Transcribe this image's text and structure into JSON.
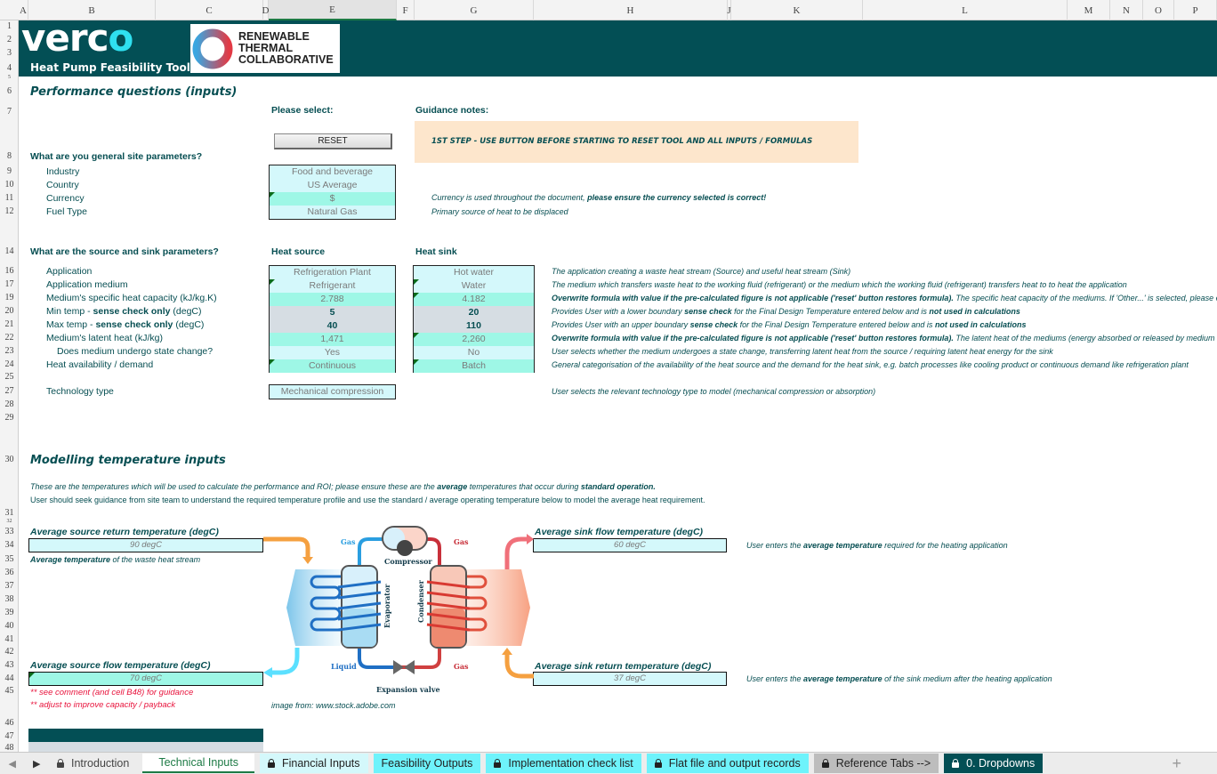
{
  "columns": [
    "A",
    "B",
    "C",
    "D",
    "E",
    "F",
    "G",
    "H",
    "J",
    "K",
    "L",
    "M",
    "N",
    "O",
    "P"
  ],
  "rows": [
    "1",
    "2",
    "3",
    "4",
    "5",
    "6",
    "7",
    "8",
    "9",
    "10",
    "11",
    "12",
    "14",
    "16",
    "17",
    "19",
    "20",
    "21",
    "22",
    "23",
    "24",
    "25",
    "27",
    "28",
    "29",
    "30",
    "31",
    "32",
    "33",
    "34",
    "35",
    "36",
    "37",
    "38",
    "39",
    "40",
    "41",
    "42",
    "43",
    "44",
    "45",
    "46",
    "47",
    "48"
  ],
  "header": {
    "logo": "verco",
    "logo_o": "o",
    "logo_main": "verc",
    "tool_title": "Heat Pump Feasibility Tool",
    "partner_logo": "RENEWABLE THERMAL COLLABORATIVE",
    "partner_lines": [
      "RENEWABLE",
      "THERMAL",
      "COLLABORATIVE"
    ]
  },
  "colors": {
    "brand": "#034f55",
    "accent": "#2fe0f0",
    "input_light": "#d4f8fb",
    "input_mid": "#9ef7e6",
    "guidance_bg": "#fde6cc",
    "warning": "#e8133c"
  },
  "section1": {
    "title": "Performance questions (inputs)",
    "please_select": "Please select:",
    "guidance_notes": "Guidance notes:",
    "reset_label": "RESET",
    "guidance_box": "1ST STEP - USE BUTTON BEFORE STARTING TO RESET TOOL AND ALL INPUTS / FORMULAS",
    "site_q": "What are you general site parameters?",
    "site": [
      {
        "label": "Industry",
        "value": "Food and beverage",
        "note": ""
      },
      {
        "label": "Country",
        "value": "US Average",
        "note": ""
      },
      {
        "label": "Currency",
        "value": "$",
        "note": "Currency is used throughout the document, ",
        "note_bold": "please ensure the currency selected is correct!"
      },
      {
        "label": "Fuel Type",
        "value": "Natural Gas",
        "note": "Primary source of heat to be displaced"
      }
    ],
    "ss_q": "What are the source and sink parameters?",
    "source_hdr": "Heat source",
    "sink_hdr": "Heat sink",
    "params": [
      {
        "label": "Application",
        "source": "Refrigeration Plant",
        "sink": "Hot water",
        "note": [
          {
            "t": "The application creating a waste heat stream (Source) and useful heat stream (Sink)"
          }
        ]
      },
      {
        "label": "Application medium",
        "source": "Refrigerant",
        "sink": "Water",
        "note": [
          {
            "t": "The medium which transfers waste heat to the working fluid (refrigerant) or the medium which the working fluid (refrigerant) transfers heat to to heat the application"
          }
        ]
      },
      {
        "label": "Medium's specific heat capacity (kJ/kg.K)",
        "source": "2.788",
        "sink": "4.182",
        "note": [
          {
            "b": "Overwrite formula with value if the pre-calculated figure is not applicable ('reset' button restores formula)."
          },
          {
            "t": "    The specific heat capacity of the mediums. If 'Other...' is selected, please enter th"
          }
        ]
      },
      {
        "label_pre": "Min temp - ",
        "label_bold": "sense check only",
        "label_post": " (degC)",
        "source": "5",
        "sink": "20",
        "note": [
          {
            "t": "Provides User with a lower boundary "
          },
          {
            "b": "sense check"
          },
          {
            "t": " for the Final Design Temperature entered below and is "
          },
          {
            "b": "not used in calculations"
          }
        ]
      },
      {
        "label_pre": "Max temp - ",
        "label_bold": "sense check only",
        "label_post": " (degC)",
        "source": "40",
        "sink": "110",
        "note": [
          {
            "t": "Provides User with an upper boundary "
          },
          {
            "b": "sense check"
          },
          {
            "t": " for the Final Design Temperature entered below and is "
          },
          {
            "b": "not used in calculations"
          }
        ]
      },
      {
        "label": "Medium's latent heat (kJ/kg)",
        "source": "1,471",
        "sink": "2,260",
        "note": [
          {
            "b": "Overwrite formula with value if the pre-calculated figure is not applicable ('reset' button restores formula)."
          },
          {
            "t": "    The latent heat of the mediums (energy absorbed or released by medium during"
          }
        ]
      },
      {
        "label": "Does medium undergo state change?",
        "source": "Yes",
        "sink": "No",
        "note": [
          {
            "t": "   User selects whether the medium undergoes a state change, transferring latent heat from the source / requiring latent heat energy for the sink"
          }
        ]
      },
      {
        "label": "Heat availability / demand",
        "source": "Continuous",
        "sink": "Batch",
        "note": [
          {
            "t": "General categorisation of the availability of the heat source and the demand for the heat sink, e.g. batch processes like cooling product or continuous demand like refrigeration plant"
          }
        ]
      }
    ],
    "tech_label": "Technology type",
    "tech_value": "Mechanical compression",
    "tech_note": "User selects the relevant technology type to model (mechanical compression or absorption)"
  },
  "section2": {
    "title": "Modelling temperature inputs",
    "intro1": [
      {
        "t": "These are the temperatures which will be used to calculate the performance and ROI; please ensure these are the "
      },
      {
        "b": "average"
      },
      {
        "t": " temperatures that occur during "
      },
      {
        "b": "standard operation."
      }
    ],
    "intro2": "User should seek guidance from site team to understand the required temperature profile and use the standard / average operating temperature below to model the average heat requirement.",
    "src_return_label": "Average source return temperature (degC)",
    "src_return_value": "90 degC",
    "src_return_note_bold": "Average temperature",
    "src_return_note": " of the waste heat stream",
    "src_flow_label": "Average source flow temperature (degC)",
    "src_flow_value": "70 degC",
    "warn1": "** see comment (and cell B48) for guidance",
    "warn2": "** adjust to improve capacity / payback",
    "sink_flow_label": "Average sink flow temperature (degC)",
    "sink_flow_value": "60 degC",
    "sink_flow_note_pre": "User enters the ",
    "sink_flow_note_bold": "average temperature",
    "sink_flow_note_post": " required for the heating application",
    "sink_return_label": "Average sink return temperature (degC)",
    "sink_return_value": "37 degC",
    "sink_return_note_pre": "User enters the ",
    "sink_return_note_bold": "average temperature",
    "sink_return_note_post": " of the sink medium after the heating application",
    "diagram": {
      "gas_tl": "Gas",
      "gas_tr": "Gas",
      "gas_br": "Gas",
      "liquid": "Liquid",
      "compressor": "Compressor",
      "evaporator": "Evaporator",
      "condenser": "Condenser",
      "valve": "Expansion valve"
    },
    "credit": "image from: www.stock.adobe.com"
  },
  "tabs": [
    {
      "label": "Introduction",
      "locked": true,
      "style": "grey"
    },
    {
      "label": "Technical Inputs",
      "locked": false,
      "style": "active"
    },
    {
      "label": "Financial Inputs",
      "locked": true,
      "style": "light"
    },
    {
      "label": "Feasibility Outputs",
      "locked": false,
      "style": "cyan"
    },
    {
      "label": "Implementation check list",
      "locked": true,
      "style": "cyan"
    },
    {
      "label": "Flat file and output records",
      "locked": true,
      "style": "cyan"
    },
    {
      "label": "Reference Tabs -->",
      "locked": true,
      "style": "gray2"
    },
    {
      "label": "0. Dropdowns",
      "locked": true,
      "style": "dark"
    }
  ]
}
